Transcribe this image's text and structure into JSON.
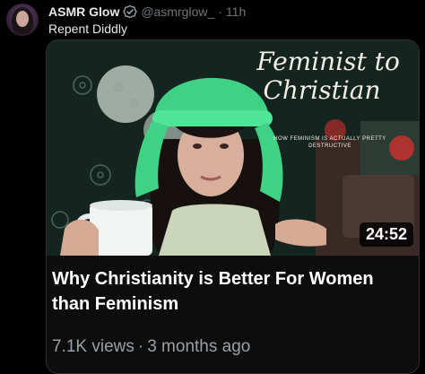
{
  "post": {
    "author_name": "ASMR Glow",
    "author_handle": "@asmrglow_",
    "separator": "·",
    "time": "11h",
    "text": "Repent Diddly"
  },
  "video_card": {
    "overlay_title_line1": "Feminist to",
    "overlay_title_line2": "Christian",
    "overlay_subtitle": "HOW FEMINISM IS ACTUALLY PRETTY DESTRUCTIVE",
    "duration": "24:52",
    "title": "Why Christianity is Better For Women than Feminism",
    "views": "7.1K views",
    "meta_separator": "·",
    "age": "3 months ago"
  },
  "colors": {
    "background": "#000000",
    "text_primary": "#e7e9ea",
    "text_secondary": "#71767b",
    "verified_badge": "#9aa0a6",
    "hat_green": "#3fd184",
    "wallpaper_green": "#152620"
  },
  "icons": {
    "verified": "verified-badge-icon"
  }
}
